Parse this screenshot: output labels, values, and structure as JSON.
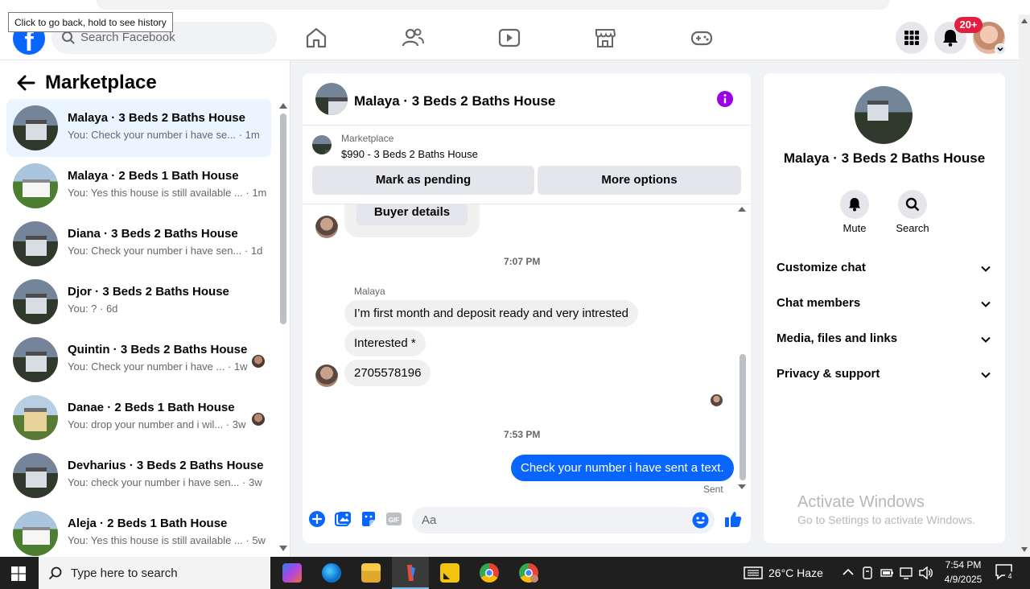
{
  "browser": {
    "tooltip": "Click to go back, hold to see history"
  },
  "header": {
    "logo_letter": "f",
    "search_placeholder": "Search Facebook",
    "nav_icons": [
      "home-icon",
      "friends-icon",
      "video-icon",
      "marketplace-icon",
      "gaming-icon"
    ],
    "menu_icon": "grid-menu-icon",
    "notification_badge": "20+",
    "brand_color": "#0866ff"
  },
  "sidebar": {
    "title": "Marketplace",
    "chats": [
      {
        "title": "Malaya · 3 Beds 2 Baths House",
        "preview": "You: Check your number i have se... · 1m",
        "thumb": "house-grey",
        "active": true,
        "seen": false
      },
      {
        "title": "Malaya · 2 Beds 1 Bath House",
        "preview": "You: Yes this house is still available ... · 1m",
        "thumb": "house-white",
        "active": false,
        "seen": false
      },
      {
        "title": "Diana · 3 Beds 2 Baths House",
        "preview": "You: Check your number i have sen... · 1d",
        "thumb": "house-grey",
        "active": false,
        "seen": false
      },
      {
        "title": "Djor · 3 Beds 2 Baths House",
        "preview": "You: ? · 6d",
        "thumb": "house-grey",
        "active": false,
        "seen": false
      },
      {
        "title": "Quintin · 3 Beds 2 Baths House",
        "preview": "You: Check your number i have ... · 1w",
        "thumb": "house-grey",
        "active": false,
        "seen": true
      },
      {
        "title": "Danae · 2 Beds 1 Bath House",
        "preview": "You: drop your number and i wil... · 3w",
        "thumb": "house-yellow",
        "active": false,
        "seen": true
      },
      {
        "title": "Devharius · 3 Beds 2 Baths House",
        "preview": "You: check your number i have sen... · 3w",
        "thumb": "house-grey",
        "active": false,
        "seen": false
      },
      {
        "title": "Aleja · 2 Beds 1 Bath House",
        "preview": "You: Yes this house is still available ... · 5w",
        "thumb": "house-white",
        "active": false,
        "seen": false
      }
    ]
  },
  "chat": {
    "title": "Malaya · 3 Beds 2 Baths House",
    "marketplace_label": "Marketplace",
    "listing_price": "$990 - 3 Beds 2 Baths House",
    "mark_pending_label": "Mark as pending",
    "more_options_label": "More options",
    "buyer_details_label": "Buyer details",
    "timestamp_1": "7:07 PM",
    "sender_name": "Malaya",
    "incoming_messages": [
      "I’m first month and deposit ready and very intrested",
      "Interested *",
      "2705578196"
    ],
    "timestamp_2": "7:53 PM",
    "outgoing_message": "Check your number i have sent a text.",
    "sent_status": "Sent",
    "compose_placeholder": "Aa"
  },
  "details": {
    "name": "Malaya · 3 Beds 2 Baths House",
    "mute_label": "Mute",
    "search_label": "Search",
    "rows": [
      "Customize chat",
      "Chat members",
      "Media, files and links",
      "Privacy & support"
    ]
  },
  "watermark": {
    "line1": "Activate Windows",
    "line2": "Go to Settings to activate Windows."
  },
  "taskbar": {
    "search_placeholder": "Type here to search",
    "weather": "26°C Haze",
    "time": "7:54 PM",
    "date": "4/9/2025",
    "notification_count": "4"
  }
}
